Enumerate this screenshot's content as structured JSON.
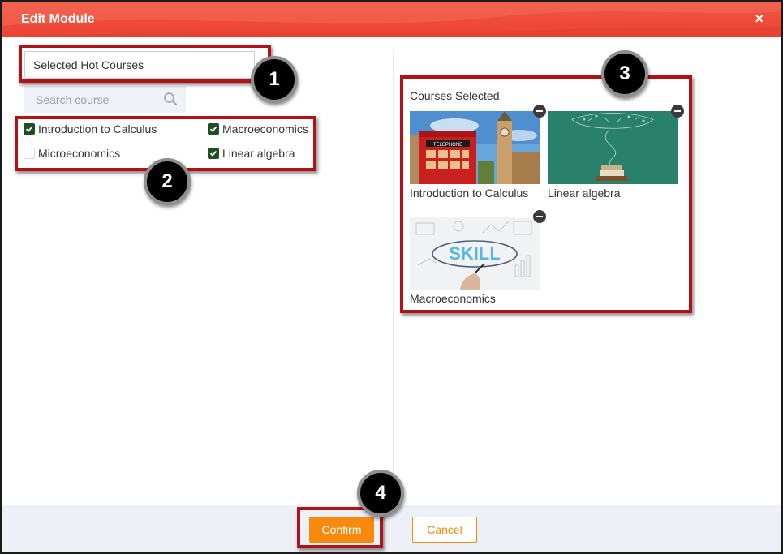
{
  "window": {
    "title": "Edit Module",
    "close_glyph": "×",
    "header_color": "#ef4b3a"
  },
  "module_name": {
    "value": "Selected Hot Courses"
  },
  "search": {
    "placeholder": "Search course",
    "icon": "search-icon"
  },
  "course_list": [
    {
      "label": "Introduction to Calculus",
      "checked": true
    },
    {
      "label": "Macroeconomics",
      "checked": true
    },
    {
      "label": "Microeconomics",
      "checked": false
    },
    {
      "label": "Linear algebra",
      "checked": true
    }
  ],
  "selected": {
    "title": "Courses Selected",
    "courses": [
      {
        "name": "Introduction to Calculus",
        "thumbnail": "london-telephone-booth-big-ben"
      },
      {
        "name": "Linear algebra",
        "thumbnail": "chalkboard-book-doodles"
      },
      {
        "name": "Macroeconomics",
        "thumbnail": "skill-sketch"
      }
    ]
  },
  "footer": {
    "confirm_label": "Confirm",
    "cancel_label": "Cancel",
    "accent_color": "#f7890d"
  },
  "callouts": {
    "colors": {
      "box": "#b01217",
      "badge": "#000000"
    },
    "badges": [
      "1",
      "2",
      "3",
      "4"
    ]
  }
}
